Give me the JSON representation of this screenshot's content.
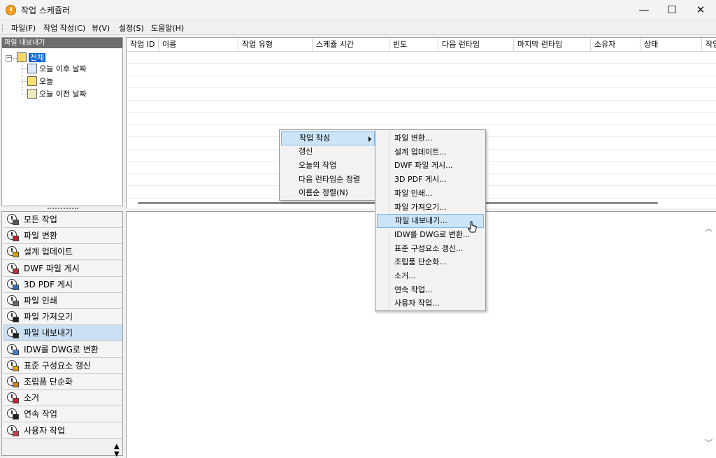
{
  "window": {
    "title": "작업 스케쥴러",
    "min": "—",
    "max": "☐",
    "close": "✕"
  },
  "menu": [
    {
      "label": "파일(F)"
    },
    {
      "label": "작업 작성(C)"
    },
    {
      "label": "뷰(V)"
    },
    {
      "label": "설정(S)"
    },
    {
      "label": "도움말(H)"
    }
  ],
  "tree": {
    "header": "파일 내보내기",
    "root": "전체",
    "children": [
      "오늘 이후 날짜",
      "오늘",
      "오늘 이전 날짜"
    ]
  },
  "nav": [
    {
      "label": "모든 작업",
      "color": "#555555"
    },
    {
      "label": "파일 변환",
      "color": "#c02020"
    },
    {
      "label": "설계 업데이트",
      "color": "#e0a000"
    },
    {
      "label": "DWF 파일 게시",
      "color": "#c03030"
    },
    {
      "label": "3D PDF 게시",
      "color": "#3070c0"
    },
    {
      "label": "파일 인쇄",
      "color": "#666666"
    },
    {
      "label": "파일 가져오기",
      "color": "#222222"
    },
    {
      "label": "파일 내보내기",
      "color": "#222222"
    },
    {
      "label": "IDW를 DWG로 변환",
      "color": "#3a7fd0"
    },
    {
      "label": "표준 구성요소 갱신",
      "color": "#e0a000"
    },
    {
      "label": "조립품 단순화",
      "color": "#d08020"
    },
    {
      "label": "소거",
      "color": "#d02020"
    },
    {
      "label": "연속 작업",
      "color": "#222222"
    },
    {
      "label": "사용자 작업",
      "color": "#d04040"
    }
  ],
  "nav_selected": "파일 내보내기",
  "table": {
    "columns": [
      "작업 ID",
      "이름",
      "작업 유형",
      "스케쥴 시간",
      "빈도",
      "다음 런타임",
      "마지막 런타임",
      "소유자",
      "상태",
      "작업"
    ]
  },
  "context_menu": {
    "items": [
      "작업 작성",
      "갱신",
      "오늘의 작업",
      "다음 런타임순 정렬",
      "이름순 정렬(N)"
    ]
  },
  "submenu": {
    "items": [
      "파일 변환...",
      "설계 업데이트...",
      "DWF 파일 게시...",
      "3D PDF 게시...",
      "파일 인쇄...",
      "파일 가져오기...",
      "파일 내보내기...",
      "IDW를 DWG로 변환...",
      "표준 구성요소 갱신...",
      "조립품 단순화...",
      "소거...",
      "연속 작업...",
      "사용자 작업..."
    ]
  }
}
